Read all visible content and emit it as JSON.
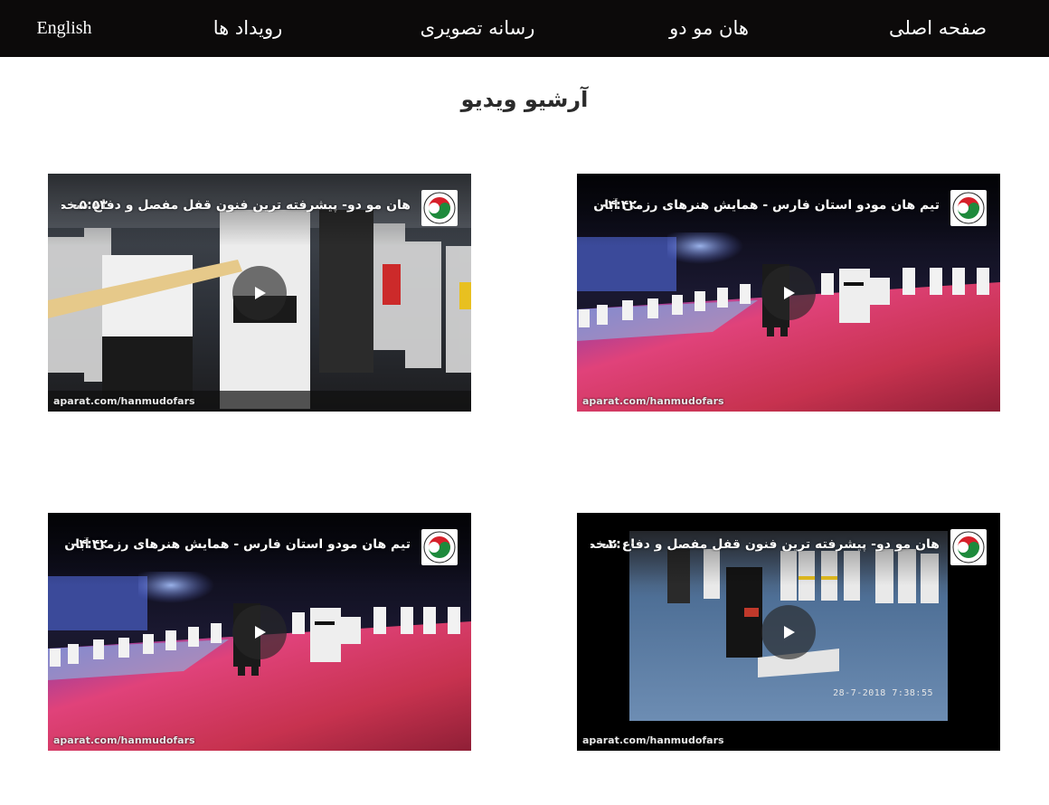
{
  "nav": {
    "items": [
      "صفحه اصلی",
      "هان مو دو",
      "رسانه تصویری",
      "رویداد ها"
    ],
    "language": "English"
  },
  "page_title": "آرشیو ویدیو",
  "videos": [
    {
      "title": "تیم هان مودو استان فارس - همایش هنرهای رزمی آبان ما",
      "duration": "۰۴:۴۲",
      "watermark": "aparat.com/hanmudofars",
      "scene": "mat-pink",
      "logo_icon": "channel-logo-icon"
    },
    {
      "title": "هان مو دو- پیشرفته ترین فنون قفل مفصل و دفاع شخصی",
      "duration": "۰۵:۵۳",
      "watermark": "aparat.com/hanmudofars",
      "scene": "crowd-stick",
      "logo_icon": "channel-logo-icon"
    },
    {
      "title": "هان مو دو- پیشرفته ترین فنون قفل مفصل و دفاع شخصی",
      "duration": "۰۲:۰۰",
      "watermark": "aparat.com/hanmudofars",
      "timestamp": "28-7-2018   7:38:55",
      "scene": "mat-blue",
      "logo_icon": "channel-logo-icon"
    },
    {
      "title": "تیم هان مودو استان فارس - همایش هنرهای رزمی آبان ما",
      "duration": "۰۴:۴۲",
      "watermark": "aparat.com/hanmudofars",
      "scene": "mat-pink",
      "logo_icon": "channel-logo-icon"
    }
  ],
  "colors": {
    "navbar_bg": "#0c0a0a",
    "nav_text": "#ffffff",
    "title_text": "#2b2b2b",
    "logo_red": "#d6202a",
    "logo_green": "#1e8a3c"
  }
}
